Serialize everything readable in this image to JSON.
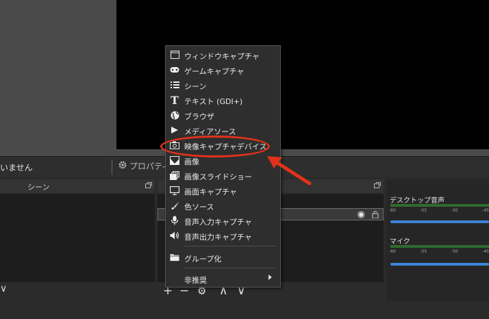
{
  "toolbar": {
    "no_source_label": "いません",
    "properties_label": "プロパティ"
  },
  "scenes_panel": {
    "title": "シーン"
  },
  "sources_panel": {
    "footer": {
      "add": "+",
      "remove": "−",
      "settings": "⚙",
      "up": "∧",
      "down": "∨"
    }
  },
  "mixer": {
    "tracks": [
      {
        "name": "デスクトップ音声",
        "ticks": [
          "-60",
          "-55",
          "-50",
          "-45"
        ]
      },
      {
        "name": "マイク",
        "ticks": [
          "-60",
          "-55",
          "-50",
          "-45"
        ]
      }
    ]
  },
  "context_menu": {
    "items": [
      {
        "label": "ウィンドウキャプチャ",
        "icon": "window-icon"
      },
      {
        "label": "ゲームキャプチャ",
        "icon": "gamepad-icon"
      },
      {
        "label": "シーン",
        "icon": "list-icon"
      },
      {
        "label": "テキスト (GDI+)",
        "icon": "text-icon"
      },
      {
        "label": "ブラウザ",
        "icon": "globe-icon"
      },
      {
        "label": "メディアソース",
        "icon": "play-icon"
      },
      {
        "label": "映像キャプチャデバイス",
        "icon": "camera-icon"
      },
      {
        "label": "画像",
        "icon": "image-icon"
      },
      {
        "label": "画像スライドショー",
        "icon": "slideshow-icon"
      },
      {
        "label": "画面キャプチャ",
        "icon": "monitor-icon"
      },
      {
        "label": "色ソース",
        "icon": "brush-icon"
      },
      {
        "label": "音声入力キャプチャ",
        "icon": "microphone-icon"
      },
      {
        "label": "音声出力キャプチャ",
        "icon": "speaker-icon"
      }
    ],
    "group_label": "グループ化",
    "deprecated_label": "非推奨"
  },
  "colors": {
    "highlight": "#e0321a",
    "meter_green": "#2f6b2f",
    "slider_blue": "#3d85d8"
  }
}
